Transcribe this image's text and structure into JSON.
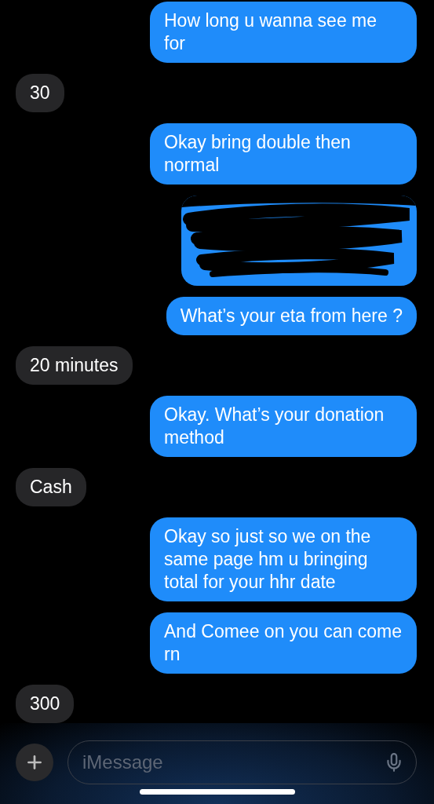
{
  "messages": [
    {
      "sent": true,
      "kind": "text",
      "text": "How long u wanna see me for"
    },
    {
      "sent": false,
      "kind": "text",
      "text": "30"
    },
    {
      "sent": true,
      "kind": "text",
      "text": "Okay bring double then normal"
    },
    {
      "sent": true,
      "kind": "redacted"
    },
    {
      "sent": true,
      "kind": "text",
      "text": "What’s your eta from here ?"
    },
    {
      "sent": false,
      "kind": "text",
      "text": "20 minutes"
    },
    {
      "sent": true,
      "kind": "text",
      "text": "Okay. What’s your donation method"
    },
    {
      "sent": false,
      "kind": "text",
      "text": "Cash"
    },
    {
      "sent": true,
      "kind": "text",
      "text": "Okay so just so we on the same page hm u bringing total for your hhr date"
    },
    {
      "sent": true,
      "kind": "text",
      "text": "And Comee on you can come rn"
    },
    {
      "sent": false,
      "kind": "text",
      "text": "300"
    }
  ],
  "composer": {
    "placeholder": "iMessage"
  }
}
